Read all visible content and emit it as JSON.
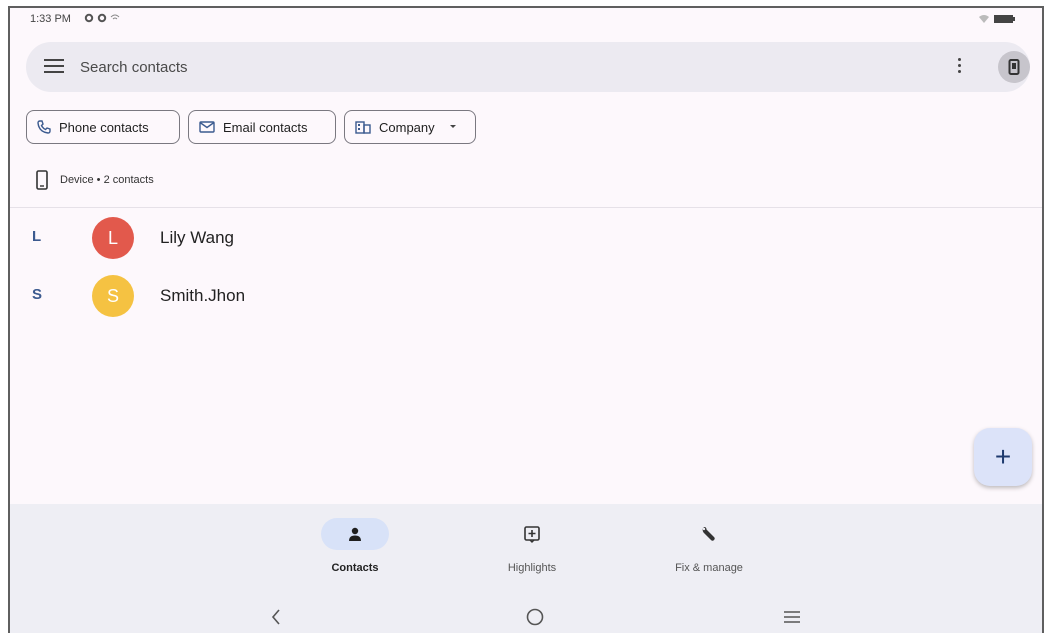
{
  "status_bar": {
    "time": "1:33 PM"
  },
  "search": {
    "placeholder": "Search contacts"
  },
  "chips": [
    {
      "label": "Phone contacts",
      "icon": "phone-icon"
    },
    {
      "label": "Email contacts",
      "icon": "email-icon"
    },
    {
      "label": "Company",
      "icon": "company-icon"
    }
  ],
  "device": {
    "label": "Device • 2 contacts"
  },
  "contacts": [
    {
      "section": "L",
      "initial": "L",
      "name": "Lily Wang",
      "color": "#e2594c"
    },
    {
      "section": "S",
      "initial": "S",
      "name": "Smith.Jhon",
      "color": "#f5c242"
    }
  ],
  "fab": {
    "label": "+"
  },
  "bottom_nav": [
    {
      "label": "Contacts",
      "icon": "person-icon",
      "active": true
    },
    {
      "label": "Highlights",
      "icon": "highlights-icon",
      "active": false
    },
    {
      "label": "Fix & manage",
      "icon": "wrench-icon",
      "active": false
    }
  ],
  "colors": {
    "accent": "#3b5a8f",
    "fab_bg": "#dce3f9",
    "nav_active": "#d8e2f8"
  }
}
